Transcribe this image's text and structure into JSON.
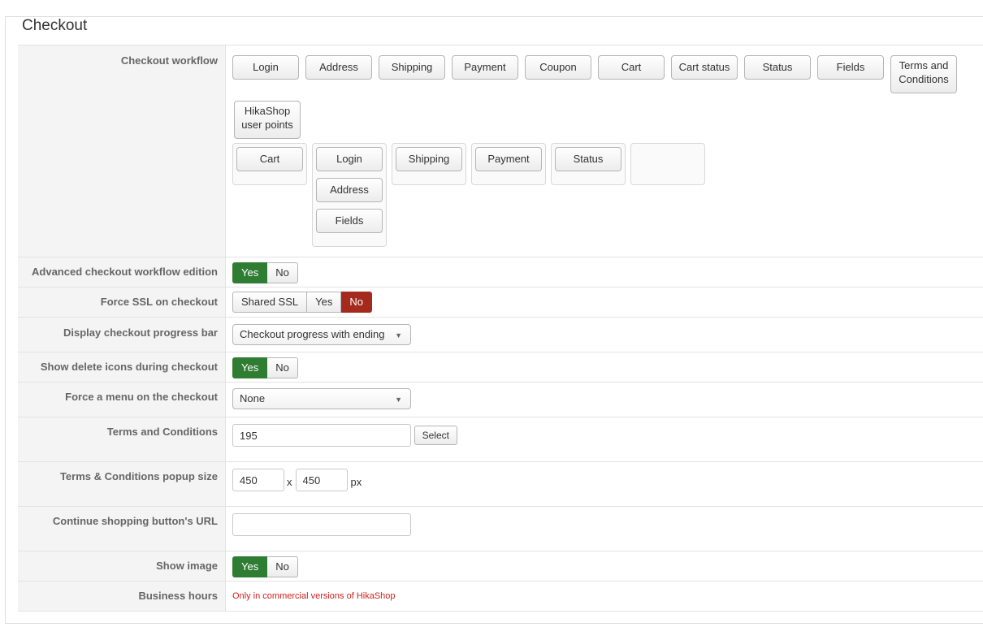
{
  "section_title": "Checkout",
  "workflow": {
    "label": "Checkout workflow",
    "available_steps": [
      "Login",
      "Address",
      "Shipping",
      "Payment",
      "Coupon",
      "Cart",
      "Cart status",
      "Status",
      "Fields",
      "Terms and Conditions",
      "HikaShop user points"
    ],
    "steps": [
      {
        "items": [
          "Cart"
        ]
      },
      {
        "items": [
          "Login",
          "Address",
          "Fields"
        ]
      },
      {
        "items": [
          "Shipping"
        ]
      },
      {
        "items": [
          "Payment"
        ]
      },
      {
        "items": [
          "Status"
        ]
      },
      {
        "items": []
      }
    ]
  },
  "rows": {
    "advanced_workflow": {
      "label": "Advanced checkout workflow edition",
      "yes": "Yes",
      "no": "No",
      "value": "Yes"
    },
    "force_ssl": {
      "label": "Force SSL on checkout",
      "shared": "Shared SSL",
      "yes": "Yes",
      "no": "No",
      "value": "No"
    },
    "progress_bar": {
      "label": "Display checkout progress bar",
      "value": "Checkout progress with ending"
    },
    "delete_icons": {
      "label": "Show delete icons during checkout",
      "yes": "Yes",
      "no": "No",
      "value": "Yes"
    },
    "force_menu": {
      "label": "Force a menu on the checkout",
      "value": "None"
    },
    "terms": {
      "label": "Terms and Conditions",
      "value": "195",
      "select_label": "Select"
    },
    "popup_size": {
      "label": "Terms & Conditions popup size",
      "width": "450",
      "height": "450",
      "x": "x",
      "unit": "px"
    },
    "continue_url": {
      "label": "Continue shopping button's URL",
      "value": ""
    },
    "show_image": {
      "label": "Show image",
      "yes": "Yes",
      "no": "No",
      "value": "Yes"
    },
    "business_hours": {
      "label": "Business hours",
      "note": "Only in commercial versions of HikaShop"
    }
  },
  "colors": {
    "yes_active": "#2f7d32",
    "no_active": "#a32a1c",
    "note_red": "#d0211c"
  }
}
